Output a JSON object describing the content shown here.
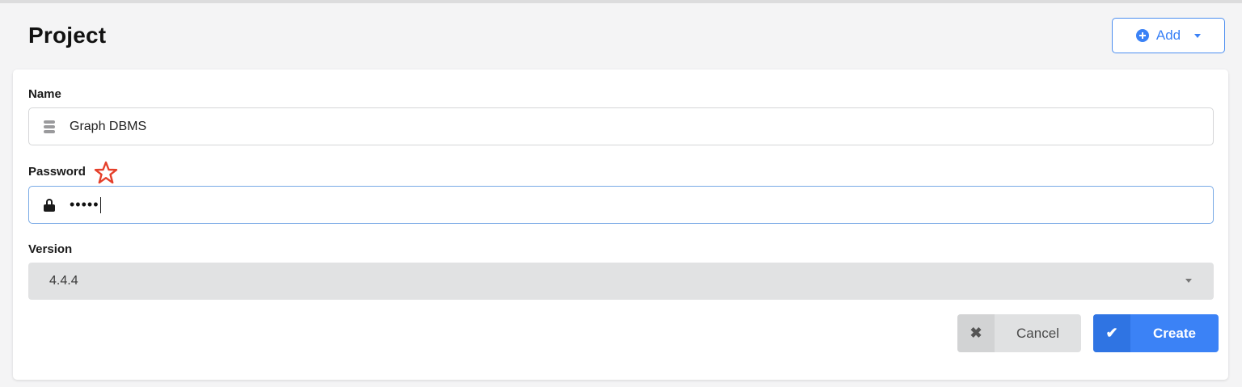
{
  "header": {
    "title": "Project",
    "add_button_label": "Add"
  },
  "form": {
    "name": {
      "label": "Name",
      "value": "Graph DBMS",
      "icon": "database-icon"
    },
    "password": {
      "label": "Password",
      "value": "•••••",
      "icon": "lock-icon",
      "required_marker": "star"
    },
    "version": {
      "label": "Version",
      "value": "4.4.4"
    }
  },
  "actions": {
    "cancel_label": "Cancel",
    "cancel_icon": "✖",
    "create_label": "Create",
    "create_icon": "✔"
  },
  "colors": {
    "accent": "#3b82f6",
    "required_star": "#e5402b"
  }
}
